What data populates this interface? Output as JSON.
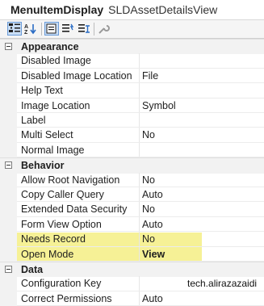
{
  "window": {
    "control_name": "MenuItemDisplay",
    "control_type": "SLDAssetDetailsView"
  },
  "toolbar": {
    "icons": [
      "categorized-icon",
      "alphabetical-icon",
      "properties-icon",
      "events-icon",
      "property-pages-icon",
      "wrench-icon"
    ]
  },
  "categories": [
    {
      "name": "Appearance",
      "properties": [
        {
          "name": "Disabled Image",
          "value": ""
        },
        {
          "name": "Disabled Image Location",
          "value": "File"
        },
        {
          "name": "Help Text",
          "value": ""
        },
        {
          "name": "Image Location",
          "value": "Symbol"
        },
        {
          "name": "Label",
          "value": ""
        },
        {
          "name": "Multi Select",
          "value": "No"
        },
        {
          "name": "Normal Image",
          "value": ""
        }
      ]
    },
    {
      "name": "Behavior",
      "properties": [
        {
          "name": "Allow Root Navigation",
          "value": "No"
        },
        {
          "name": "Copy Caller Query",
          "value": "Auto"
        },
        {
          "name": "Extended Data Security",
          "value": "No"
        },
        {
          "name": "Form View Option",
          "value": "Auto"
        },
        {
          "name": "Needs Record",
          "value": "No"
        },
        {
          "name": "Open Mode",
          "value": "View"
        }
      ]
    },
    {
      "name": "Data",
      "properties": [
        {
          "name": "Configuration Key",
          "value": ""
        },
        {
          "name": "Correct Permissions",
          "value": "Auto"
        }
      ]
    }
  ],
  "colors": {
    "highlight": "#f4ee84",
    "category_bg": "#f2f2f2",
    "toolbar_active": "#c9def5"
  },
  "watermark": "tech.alirazazaidi"
}
